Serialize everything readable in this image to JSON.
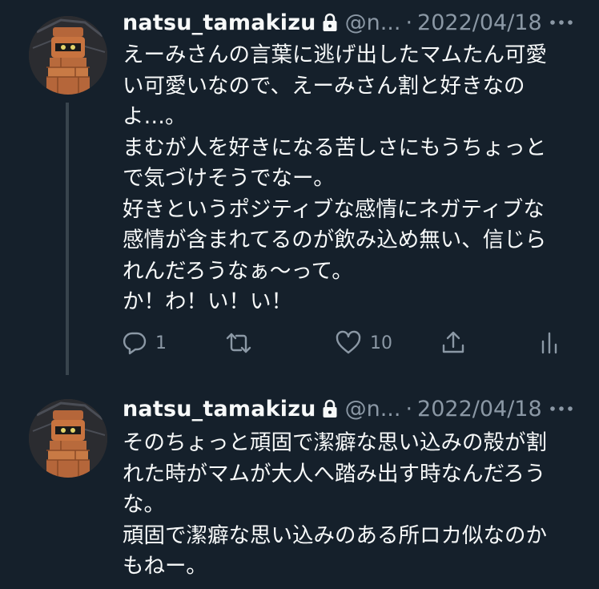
{
  "tweets": [
    {
      "display_name": "natsu_tamakizu",
      "handle": "@n...",
      "separator": "·",
      "date": "2022/04/18",
      "lines": [
        "えーみさんの言葉に逃げ出したマムたん可愛",
        "い可愛いなので、えーみさん割と好きなの",
        "よ…。",
        "まむが人を好きになる苦しさにもうちょっと",
        "で気づけそうでなー。",
        "好きというポジティブな感情にネガティブな",
        "感情が含まれてるのが飲み込め無い、信じら",
        "れんだろうなぁ〜って。",
        "か！わ！い！い！"
      ],
      "reply_count": "1",
      "like_count": "10"
    },
    {
      "display_name": "natsu_tamakizu",
      "handle": "@n...",
      "separator": "·",
      "date": "2022/04/18",
      "lines": [
        "そのちょっと頑固で潔癖な思い込みの殻が割",
        "れた時がマムが大人へ踏み出す時なんだろう",
        "な。",
        "頑固で潔癖な思い込みのある所ロカ似なのか",
        "もねー。"
      ]
    }
  ],
  "icons": {
    "lock": "lock-icon",
    "more": "more-icon",
    "reply": "reply-icon",
    "retweet": "retweet-icon",
    "like": "heart-icon",
    "share": "share-icon",
    "analytics": "analytics-icon"
  },
  "colors": {
    "background": "#15202b",
    "text": "#f7f9f9",
    "secondary": "#8b98a5",
    "thread_line": "#38444d"
  }
}
